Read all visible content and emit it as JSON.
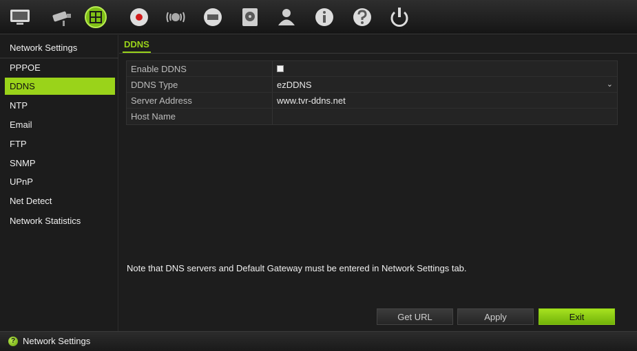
{
  "toolbar": {
    "icons": [
      {
        "name": "live-view-icon"
      },
      {
        "name": "camera-icon"
      },
      {
        "name": "network-icon",
        "active": true
      },
      {
        "name": "record-icon"
      },
      {
        "name": "alarm-icon"
      },
      {
        "name": "device-icon"
      },
      {
        "name": "hdd-icon"
      },
      {
        "name": "user-icon"
      },
      {
        "name": "info-icon"
      },
      {
        "name": "help-icon"
      },
      {
        "name": "power-icon"
      }
    ]
  },
  "sidebar": {
    "items": [
      {
        "label": "Network Settings"
      },
      {
        "label": "PPPOE"
      },
      {
        "label": "DDNS",
        "active": true
      },
      {
        "label": "NTP"
      },
      {
        "label": "Email"
      },
      {
        "label": "FTP"
      },
      {
        "label": "SNMP"
      },
      {
        "label": "UPnP"
      },
      {
        "label": "Net Detect"
      },
      {
        "label": "Network Statistics"
      }
    ]
  },
  "content": {
    "tab": "DDNS",
    "fields": {
      "enable_ddns": {
        "label": "Enable DDNS",
        "checked": false
      },
      "ddns_type": {
        "label": "DDNS Type",
        "value": "ezDDNS"
      },
      "server_address": {
        "label": "Server Address",
        "value": "www.tvr-ddns.net"
      },
      "host_name": {
        "label": "Host Name",
        "value": ""
      }
    },
    "note": "Note that DNS servers and Default Gateway must be entered in Network Settings tab.",
    "buttons": {
      "get_url": "Get URL",
      "apply": "Apply",
      "exit": "Exit"
    }
  },
  "statusbar": {
    "icon_glyph": "?",
    "text": "Network Settings"
  },
  "colors": {
    "accent": "#9ad31a",
    "background": "#1a1a1a"
  }
}
